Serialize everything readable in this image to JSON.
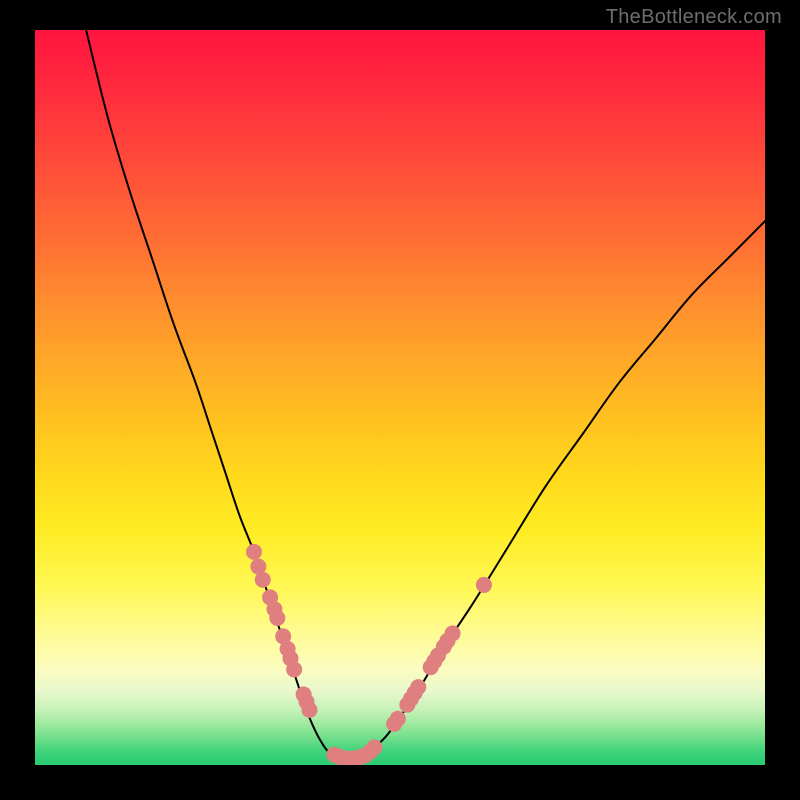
{
  "watermark": "TheBottleneck.com",
  "colors": {
    "background_frame": "#000000",
    "gradient_top": "#ff153f",
    "gradient_bottom": "#28cb73",
    "curve": "#000000",
    "marker_fill": "#e07f80",
    "marker_stroke": "#d86a6c"
  },
  "chart_data": {
    "type": "line",
    "title": "",
    "xlabel": "",
    "ylabel": "",
    "xlim": [
      0,
      100
    ],
    "ylim": [
      0,
      100
    ],
    "grid": false,
    "legend": false,
    "series": [
      {
        "name": "bottleneck-curve",
        "x": [
          7,
          10,
          13,
          16,
          19,
          22,
          24,
          26,
          28,
          30,
          31,
          32,
          33,
          34,
          35,
          36,
          37,
          38,
          39,
          40,
          41,
          42,
          43,
          44,
          45,
          46,
          48,
          50,
          53,
          56,
          60,
          65,
          70,
          75,
          80,
          85,
          90,
          95,
          100
        ],
        "y": [
          100,
          88,
          78,
          69,
          60,
          52,
          46,
          40,
          34,
          29,
          26,
          23,
          20,
          17,
          14,
          11,
          8,
          5.5,
          3.5,
          2,
          1.2,
          0.9,
          0.9,
          1,
          1.2,
          2,
          3.8,
          6.5,
          11,
          16,
          22,
          30,
          38,
          45,
          52,
          58,
          64,
          69,
          74
        ]
      }
    ],
    "markers": [
      {
        "x": 30,
        "y": 29
      },
      {
        "x": 30.6,
        "y": 27
      },
      {
        "x": 31.2,
        "y": 25.2
      },
      {
        "x": 32.2,
        "y": 22.8
      },
      {
        "x": 32.8,
        "y": 21.2
      },
      {
        "x": 33.2,
        "y": 20
      },
      {
        "x": 34,
        "y": 17.5
      },
      {
        "x": 34.6,
        "y": 15.8
      },
      {
        "x": 35,
        "y": 14.5
      },
      {
        "x": 35.5,
        "y": 13
      },
      {
        "x": 36.8,
        "y": 9.6
      },
      {
        "x": 37.2,
        "y": 8.6
      },
      {
        "x": 37.6,
        "y": 7.5
      },
      {
        "x": 41,
        "y": 1.4
      },
      {
        "x": 41.7,
        "y": 1.1
      },
      {
        "x": 42.4,
        "y": 0.9
      },
      {
        "x": 43.1,
        "y": 0.85
      },
      {
        "x": 43.8,
        "y": 0.9
      },
      {
        "x": 44.5,
        "y": 1.05
      },
      {
        "x": 45.2,
        "y": 1.3
      },
      {
        "x": 45.9,
        "y": 1.8
      },
      {
        "x": 46.5,
        "y": 2.4
      },
      {
        "x": 49.2,
        "y": 5.6
      },
      {
        "x": 49.7,
        "y": 6.3
      },
      {
        "x": 51,
        "y": 8.2
      },
      {
        "x": 51.5,
        "y": 9
      },
      {
        "x": 52,
        "y": 9.8
      },
      {
        "x": 52.5,
        "y": 10.6
      },
      {
        "x": 54.2,
        "y": 13.3
      },
      {
        "x": 54.7,
        "y": 14.1
      },
      {
        "x": 55.2,
        "y": 14.9
      },
      {
        "x": 56,
        "y": 16.1
      },
      {
        "x": 56.5,
        "y": 16.9
      },
      {
        "x": 57.2,
        "y": 17.9
      },
      {
        "x": 61.5,
        "y": 24.5
      }
    ]
  }
}
